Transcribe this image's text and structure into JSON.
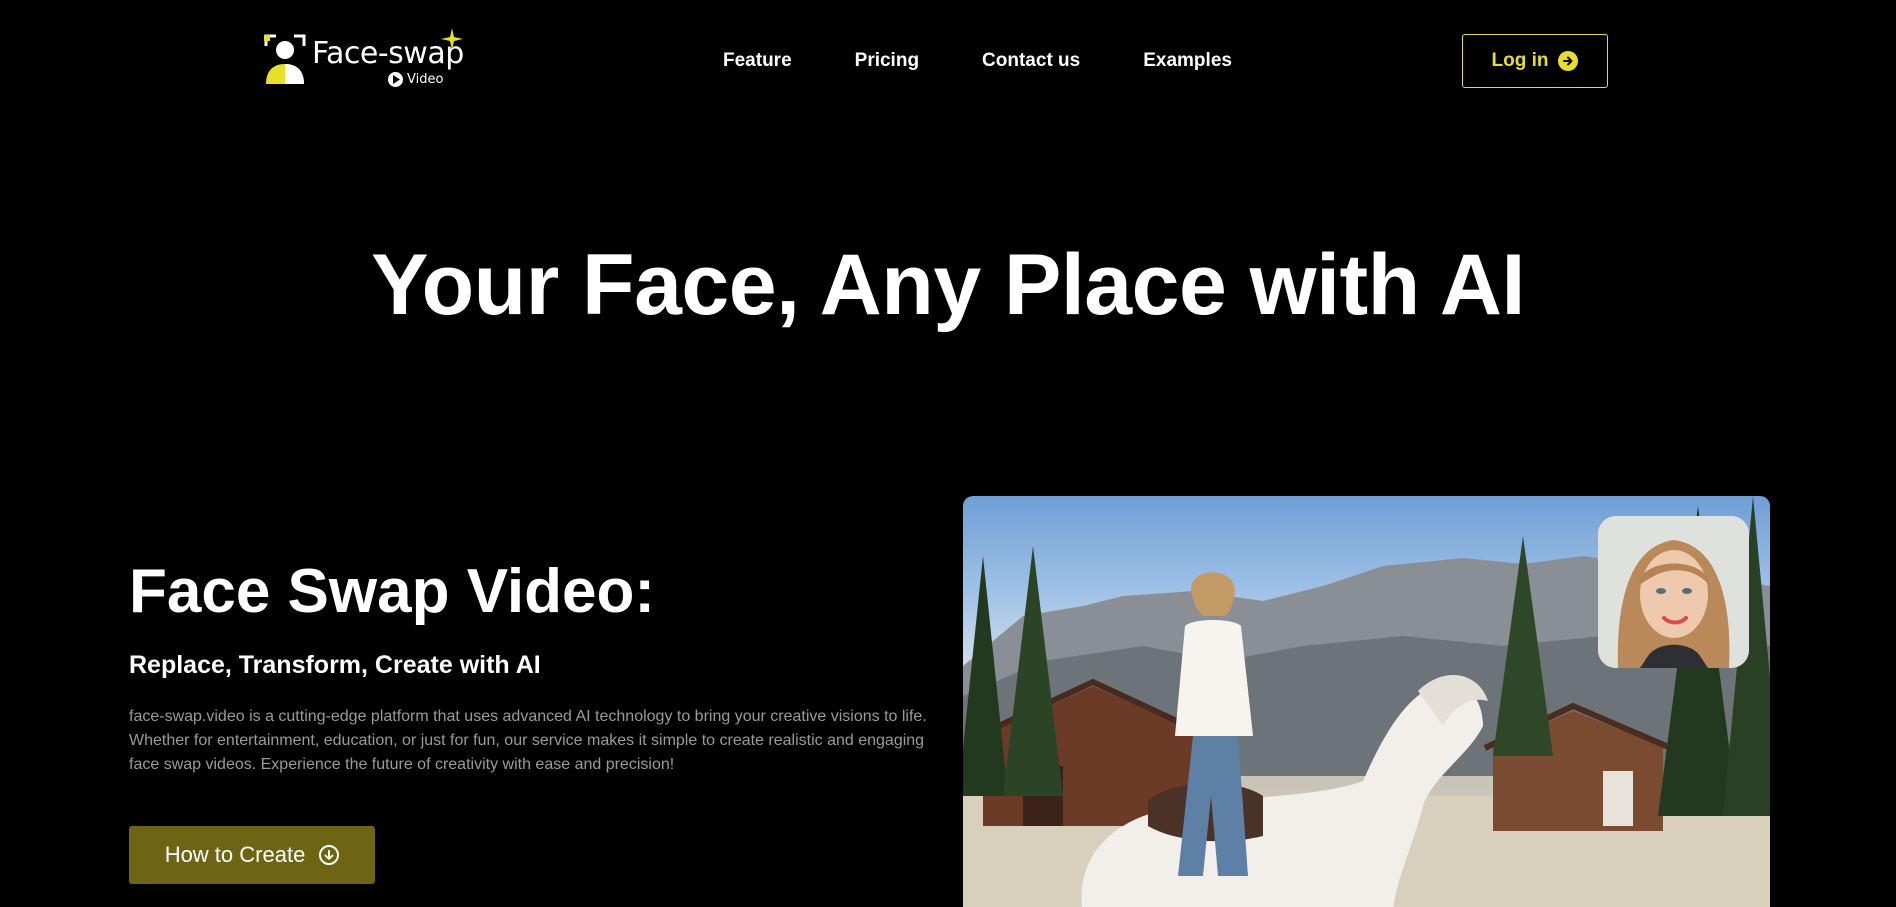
{
  "brand": {
    "name": "Face-swap",
    "sub": "Video",
    "colors": {
      "accent": "#e8df2a",
      "button_bg": "#6e6514",
      "background": "#000000"
    }
  },
  "nav": {
    "items": [
      {
        "label": "Feature"
      },
      {
        "label": "Pricing"
      },
      {
        "label": "Contact us"
      },
      {
        "label": "Examples"
      }
    ],
    "login_label": "Log in"
  },
  "hero": {
    "title": "Your Face, Any Place with AI"
  },
  "section": {
    "title": "Face Swap Video:",
    "subtitle": "Replace, Transform, Create with AI",
    "description": "face-swap.video is a cutting-edge platform that uses advanced AI technology to bring your creative visions to life. Whether for entertainment, education, or just for fun, our service makes it simple to create realistic and engaging face swap videos. Experience the future of creativity with ease and precision!",
    "cta_label": "How to Create"
  },
  "icons": {
    "logo": "face-frame-icon",
    "play": "play-icon",
    "sparkle": "sparkle-icon",
    "login": "arrow-right-circle-icon",
    "cta": "arrow-down-circle-icon"
  }
}
